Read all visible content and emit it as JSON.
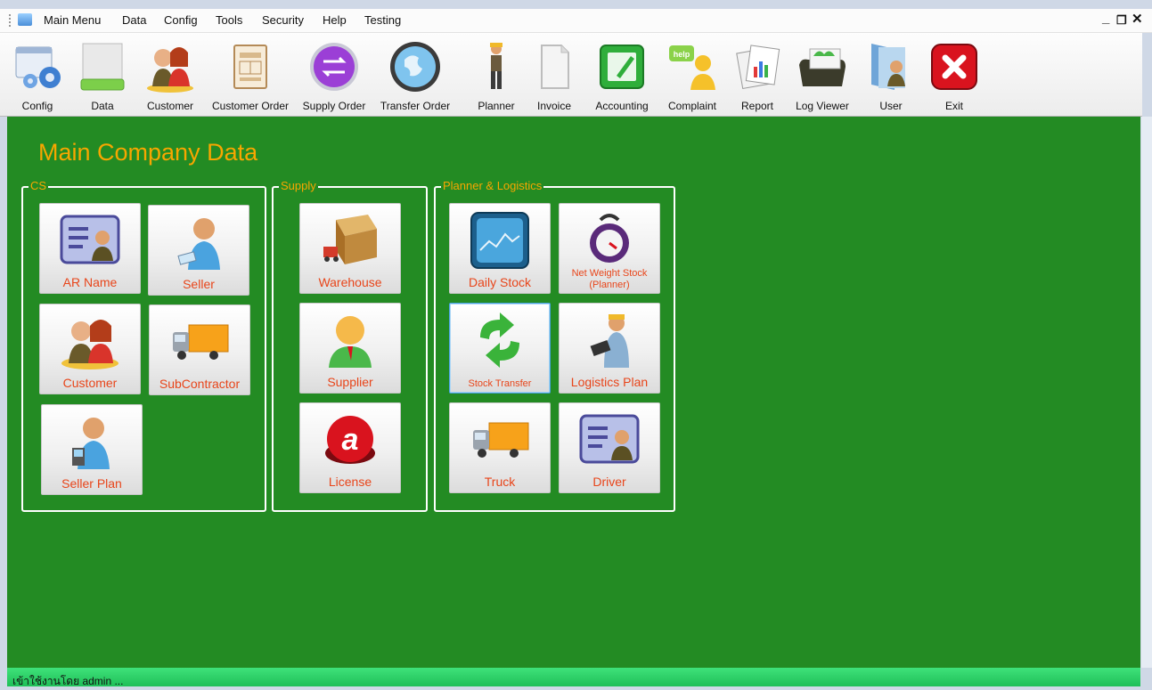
{
  "menu": {
    "items": [
      "Main Menu",
      "Data",
      "Config",
      "Tools",
      "Security",
      "Help",
      "Testing"
    ],
    "window_controls": [
      "_",
      "ว",
      "x"
    ]
  },
  "toolbar": {
    "items": [
      {
        "label": "Config",
        "icon": "config-gear-icon"
      },
      {
        "label": "Data",
        "icon": "drive-icon"
      },
      {
        "label": "Customer",
        "icon": "customer-icon"
      },
      {
        "label": "Customer Order",
        "icon": "order-form-icon"
      },
      {
        "label": "Supply Order",
        "icon": "purple-arrows-icon"
      },
      {
        "label": "Transfer Order",
        "icon": "globe-icon"
      },
      {
        "label": "Planner",
        "icon": "worker-icon"
      },
      {
        "label": "Invoice",
        "icon": "document-icon"
      },
      {
        "label": "Accounting",
        "icon": "green-pen-icon"
      },
      {
        "label": "Complaint",
        "icon": "help-icon"
      },
      {
        "label": "Report",
        "icon": "report-icon"
      },
      {
        "label": "Log Viewer",
        "icon": "folder-icon"
      },
      {
        "label": "User",
        "icon": "user-folder-icon"
      },
      {
        "label": "Exit",
        "icon": "exit-icon"
      }
    ]
  },
  "main": {
    "title": "Main Company Data",
    "groups": {
      "cs": {
        "label": "CS",
        "buttons": [
          "AR Name",
          "Seller",
          "Customer",
          "SubContractor",
          "Seller Plan"
        ]
      },
      "supply": {
        "label": "Supply",
        "buttons": [
          "Warehouse",
          "Supplier",
          "License"
        ]
      },
      "planner": {
        "label": "Planner & Logistics",
        "buttons": [
          "Daily Stock",
          "Net Weight Stock (Planner)",
          "Stock Transfer",
          "Logistics Plan",
          "Truck",
          "Driver"
        ]
      }
    }
  },
  "status": {
    "text": "เข้าใช้งานโดย admin ..."
  },
  "colors": {
    "background": "#238b23",
    "title": "#f7a600",
    "button_label": "#e8451a",
    "status_bar": "#2fd068"
  }
}
